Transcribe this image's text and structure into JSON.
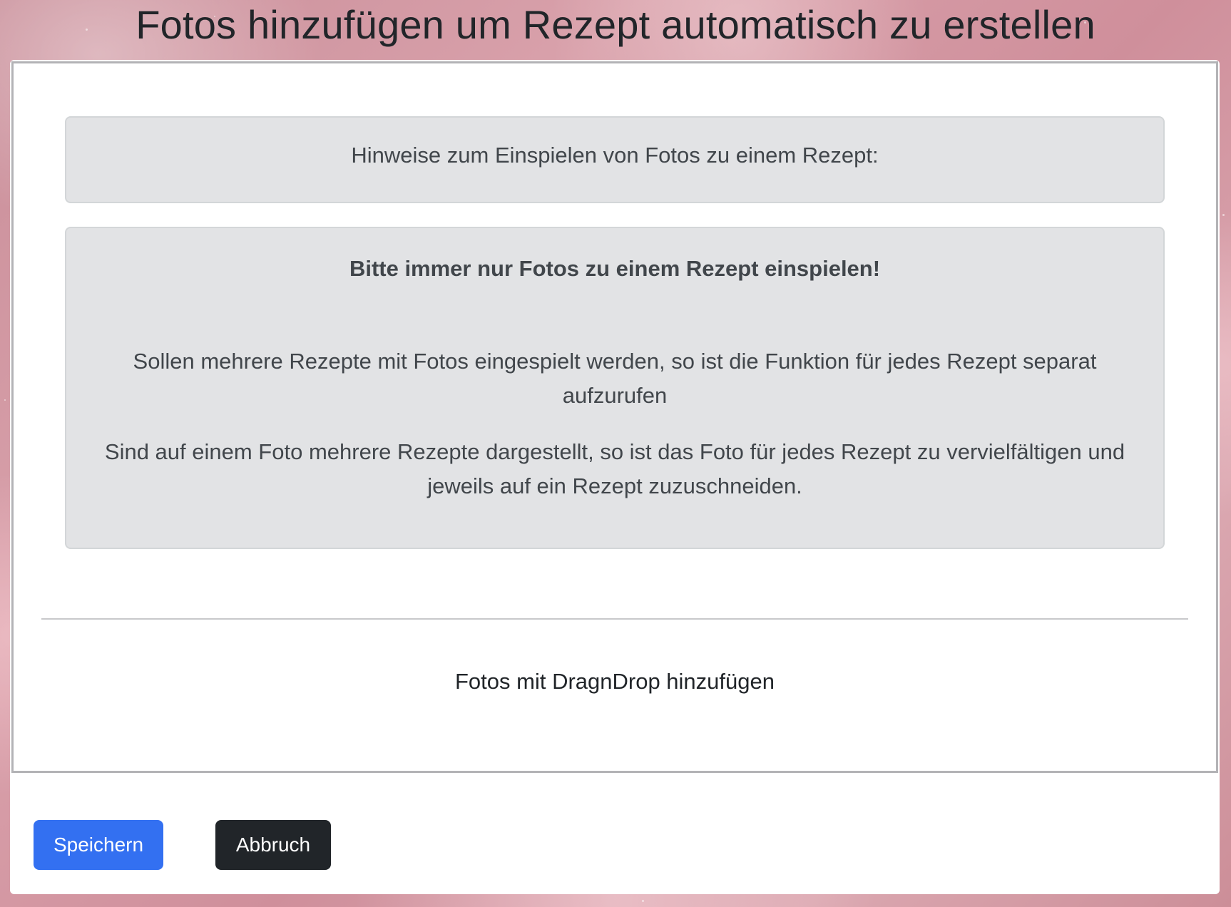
{
  "page": {
    "title": "Fotos hinzufügen um Rezept automatisch zu erstellen"
  },
  "hint_box": {
    "text": "Hinweise zum Einspielen von Fotos zu einem Rezept:"
  },
  "rules_box": {
    "heading": "Bitte immer nur Fotos zu einem Rezept einspielen!",
    "paragraphs": [
      "Sollen mehrere Rezepte mit Fotos eingespielt werden, so ist die Funktion für jedes Rezept separat aufzurufen",
      "Sind auf einem Foto mehrere Rezepte dargestellt, so ist das Foto für jedes Rezept zu vervielfältigen und jeweils auf ein Rezept zuzuschneiden."
    ]
  },
  "dropzone": {
    "label": "Fotos mit DragnDrop hinzufügen"
  },
  "actions": {
    "save_label": "Speichern",
    "cancel_label": "Abbruch"
  },
  "colors": {
    "primary": "#3370f1",
    "dark": "#212529",
    "alert_bg": "#e2e3e5",
    "alert_text": "#41464b",
    "dropzone_border": "#b3b3b6"
  }
}
